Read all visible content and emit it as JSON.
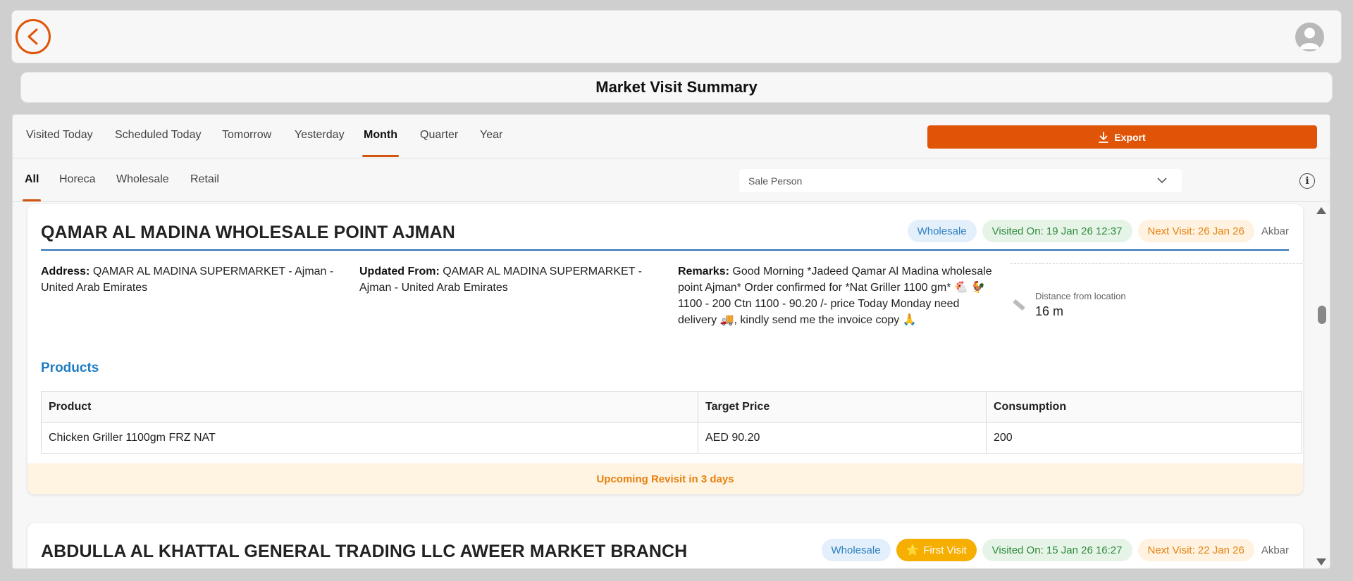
{
  "header": {
    "back_icon": "chevron-left-icon",
    "avatar_icon": "user-avatar-icon"
  },
  "page": {
    "title": "Market Visit Summary"
  },
  "period_tabs": [
    {
      "label": "Visited Today"
    },
    {
      "label": "Scheduled Today"
    },
    {
      "label": "Tomorrow"
    },
    {
      "label": "Yesterday"
    },
    {
      "label": "Month",
      "active": true
    },
    {
      "label": "Quarter"
    },
    {
      "label": "Year"
    }
  ],
  "export": {
    "label": "Export"
  },
  "category_tabs": [
    {
      "label": "All",
      "active": true
    },
    {
      "label": "Horeca"
    },
    {
      "label": "Wholesale"
    },
    {
      "label": "Retail"
    }
  ],
  "sale_person": {
    "placeholder": "Sale Person"
  },
  "colors": {
    "accent": "#e05408",
    "link_blue": "#1f7cc4",
    "header_rule": "#2a6fb3"
  },
  "visits": [
    {
      "title": "QAMAR AL MADINA WHOLESALE POINT AJMAN",
      "type_badge": "Wholesale",
      "visited_on": "Visited On: 19 Jan 26 12:37",
      "next_visit": "Next Visit: 26 Jan 26",
      "person": "Akbar",
      "address_label": "Address:",
      "address": "QAMAR AL MADINA SUPERMARKET - Ajman - United Arab Emirates",
      "updated_label": "Updated From:",
      "updated_from": "QAMAR AL MADINA SUPERMARKET - Ajman - United Arab Emirates",
      "remarks_label": "Remarks:",
      "remarks": "Good Morning *Jadeed Qamar Al Madina wholesale point Ajman* Order confirmed for *Nat Griller 1100 gm* 🐔 🐓 1100 - 200 Ctn 1100 - 90.20 /- price Today Monday need delivery 🚚, kindly send me the invoice copy 🙏",
      "distance_label": "Distance from location",
      "distance": "16 m",
      "products_title": "Products",
      "product_headers": [
        "Product",
        "Target Price",
        "Consumption"
      ],
      "products": [
        [
          "Chicken Griller 1100gm FRZ NAT",
          "AED 90.20",
          "200"
        ]
      ],
      "revisit": "Upcoming Revisit in 3 days"
    },
    {
      "title": "ABDULLA AL KHATTAL GENERAL TRADING LLC AWEER MARKET BRANCH",
      "type_badge": "Wholesale",
      "first_visit": "First Visit",
      "visited_on": "Visited On: 15 Jan 26 16:27",
      "next_visit": "Next Visit: 22 Jan 26",
      "person": "Akbar"
    }
  ]
}
